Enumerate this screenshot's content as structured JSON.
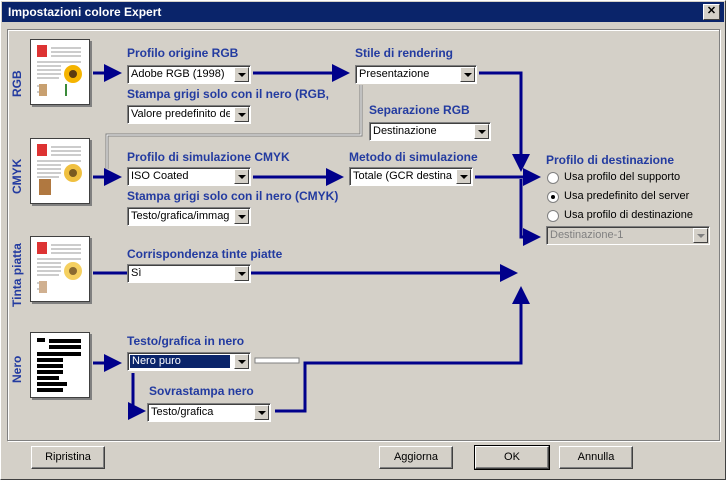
{
  "window": {
    "title": "Impostazioni colore Expert",
    "close_glyph": "✕"
  },
  "rows": {
    "rgb": "RGB",
    "cmyk": "CMYK",
    "spot": "Tinta piatta",
    "black": "Nero"
  },
  "rgb": {
    "source_label": "Profilo origine RGB",
    "source_value": "Adobe RGB (1998)",
    "gray_label": "Stampa grigi solo con il nero (RGB,",
    "gray_value": "Valore predefinito dell",
    "intent_label": "Stile di rendering",
    "intent_value": "Presentazione",
    "separation_label": "Separazione RGB",
    "separation_value": "Destinazione"
  },
  "cmyk": {
    "sim_label": "Profilo di simulazione CMYK",
    "sim_value": "ISO Coated",
    "method_label": "Metodo di simulazione",
    "method_value": "Totale (GCR destinaz",
    "gray_label": "Stampa grigi solo con il nero (CMYK)",
    "gray_value": "Testo/grafica/immagi"
  },
  "spot": {
    "match_label": "Corrispondenza tinte piatte",
    "match_value": "Sì"
  },
  "black": {
    "text_label": "Testo/grafica in nero",
    "text_value": "Nero puro",
    "overprint_label": "Sovrastampa nero",
    "overprint_value": "Testo/grafica"
  },
  "destination": {
    "label": "Profilo di destinazione",
    "options": [
      "Usa profilo del supporto",
      "Usa predefinito del server",
      "Usa profilo di destinazione"
    ],
    "selected_index": 1,
    "profile_value": "Destinazione-1"
  },
  "buttons": {
    "reset": "Ripristina",
    "update": "Aggiorna",
    "ok": "OK",
    "cancel": "Annulla"
  },
  "colors": {
    "flow": "#00008b",
    "label": "#233ba0",
    "titlebar": "#0a246a"
  }
}
